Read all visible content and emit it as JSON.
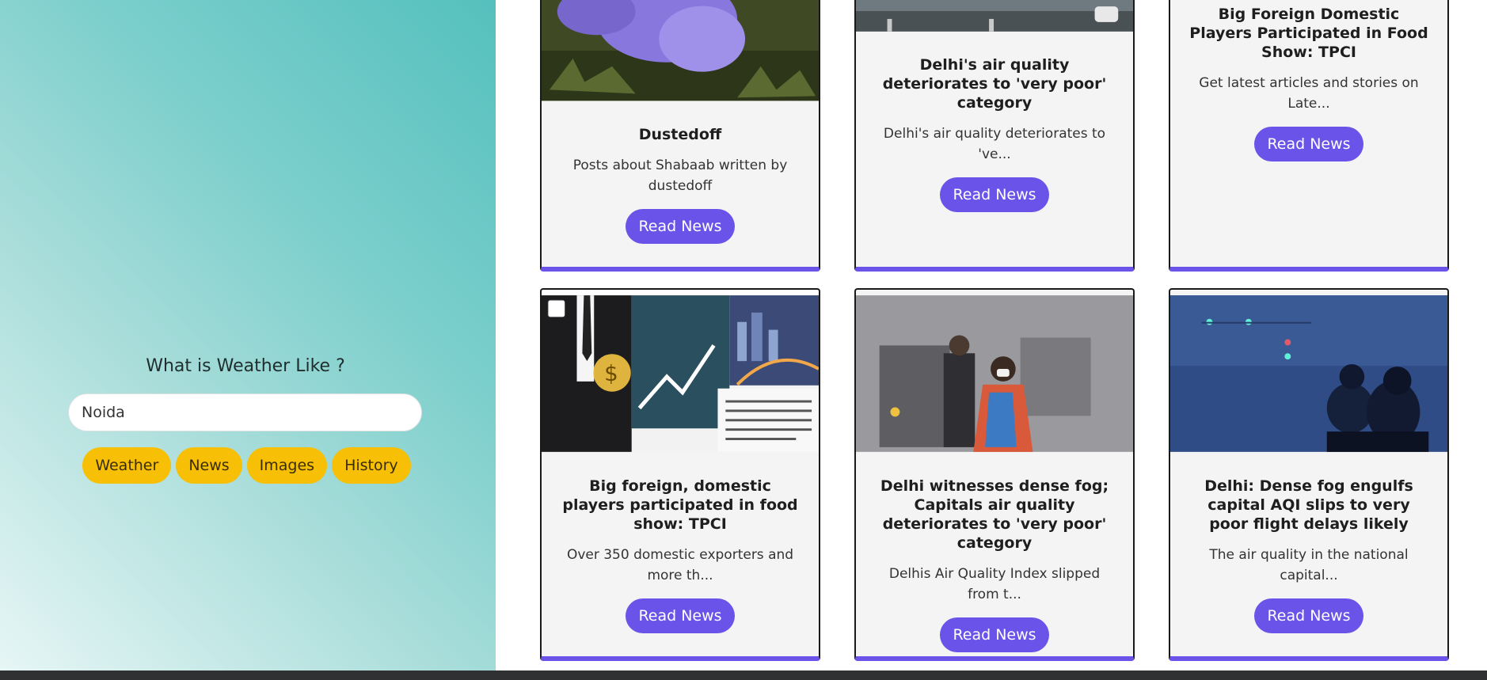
{
  "search": {
    "heading": "What is Weather Like ?",
    "value": "Noida"
  },
  "buttons": {
    "weather": "Weather",
    "news": "News",
    "images": "Images",
    "history": "History"
  },
  "cards": [
    {
      "title": "Dustedoff",
      "desc": "Posts about Shabaab written by dustedoff",
      "button": "Read News",
      "image": "purple-flower-photo"
    },
    {
      "title": "Delhi's air quality deteriorates to 'very poor' category",
      "desc": "Delhi's air quality deteriorates to 've...",
      "button": "Read News",
      "image": "road-photo"
    },
    {
      "title": "Big Foreign Domestic Players Participated in Food Show: TPCI",
      "desc": "Get latest articles and stories on Late...",
      "button": "Read News",
      "image": ""
    },
    {
      "title": "Big foreign, domestic players participated in food show: TPCI",
      "desc": "Over 350 domestic exporters and more th...",
      "button": "Read News",
      "image": "business-collage-photo"
    },
    {
      "title": "Delhi witnesses dense fog; Capitals air quality deteriorates to 'very poor' category",
      "desc": "Delhis Air Quality Index slipped from t...",
      "button": "Read News",
      "image": "woman-in-smog-photo"
    },
    {
      "title": "Delhi: Dense fog engulfs capital AQI slips to very poor flight delays likely",
      "desc": "The air quality in the national capital...",
      "button": "Read News",
      "image": "foggy-street-photo"
    }
  ],
  "colors": {
    "accent": "#6a53e8",
    "pill": "#f7bf06",
    "teal": "#55c0bd"
  }
}
